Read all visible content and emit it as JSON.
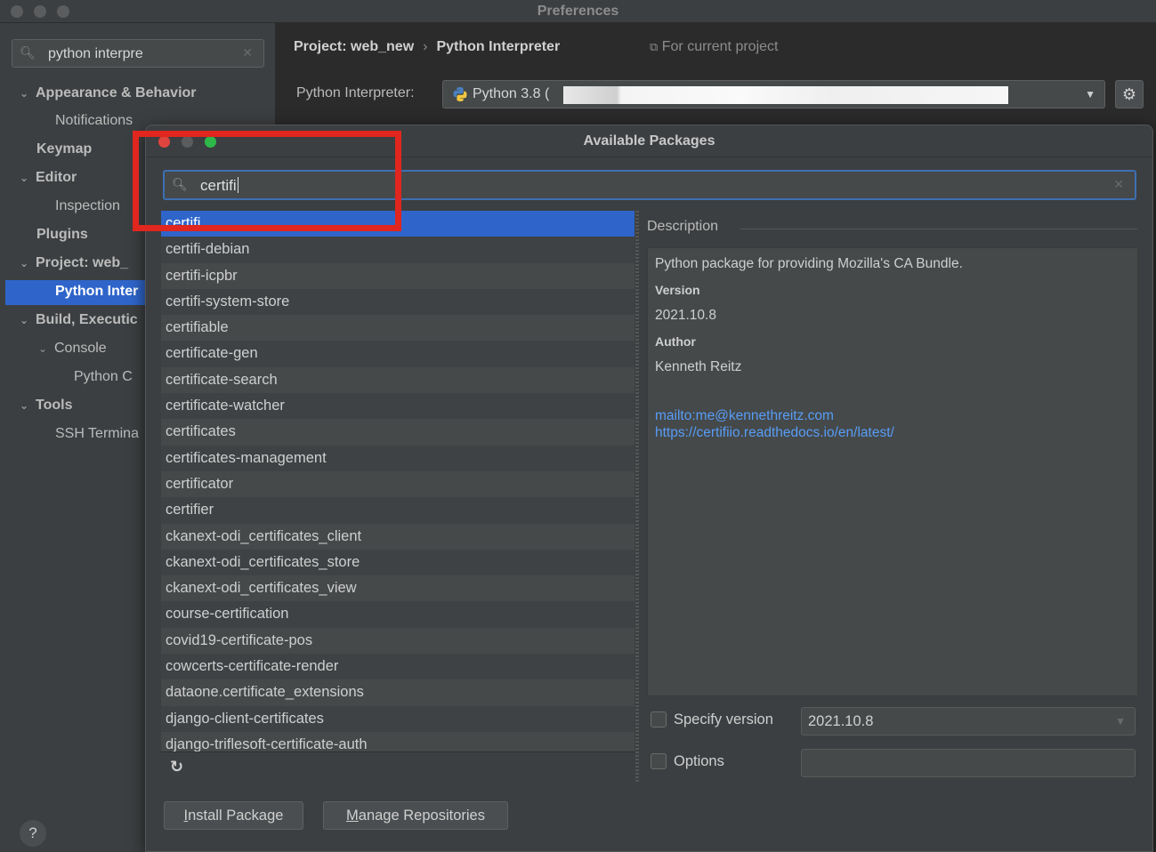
{
  "window": {
    "title": "Preferences"
  },
  "sidebar": {
    "search_value": "python interpre",
    "items": [
      {
        "label": "Appearance & Behavior",
        "bold": true,
        "chevron": true
      },
      {
        "label": "Notifications",
        "bold": false,
        "chevron": false
      },
      {
        "label": "Keymap",
        "bold": true,
        "chevron": false
      },
      {
        "label": "Editor",
        "bold": true,
        "chevron": true
      },
      {
        "label": "Inspection",
        "bold": false,
        "chevron": false
      },
      {
        "label": "Plugins",
        "bold": true,
        "chevron": false
      },
      {
        "label": "Project: web_",
        "bold": true,
        "chevron": true
      },
      {
        "label": "Python Inter",
        "bold": true,
        "chevron": false,
        "selected": true
      },
      {
        "label": "Build, Executic",
        "bold": true,
        "chevron": true
      },
      {
        "label": "Console",
        "bold": false,
        "chevron": true
      },
      {
        "label": "Python C",
        "bold": false,
        "chevron": false
      },
      {
        "label": "Tools",
        "bold": true,
        "chevron": true
      },
      {
        "label": "SSH Termina",
        "bold": false,
        "chevron": false
      }
    ],
    "help_label": "?"
  },
  "header": {
    "crumb_project": "Project: web_new",
    "crumb_separator": "›",
    "crumb_page": "Python Interpreter",
    "for_current_project": "For current project",
    "interpreter_label": "Python Interpreter:",
    "interpreter_value": "Python 3.8 ("
  },
  "dialog": {
    "title": "Available Packages",
    "search_value": "certifi",
    "packages": [
      "certifi",
      "certifi-debian",
      "certifi-icpbr",
      "certifi-system-store",
      "certifiable",
      "certificate-gen",
      "certificate-search",
      "certificate-watcher",
      "certificates",
      "certificates-management",
      "certificator",
      "certifier",
      "ckanext-odi_certificates_client",
      "ckanext-odi_certificates_store",
      "ckanext-odi_certificates_view",
      "course-certification",
      "covid19-certificate-pos",
      "cowcerts-certificate-render",
      "dataone.certificate_extensions",
      "django-client-certificates",
      "django-triflesoft-certificate-auth"
    ],
    "selected_index": 0,
    "description": {
      "header": "Description",
      "summary": "Python package for providing Mozilla's CA Bundle.",
      "version_label": "Version",
      "version_value": "2021.10.8",
      "author_label": "Author",
      "author_value": "Kenneth Reitz",
      "link_email": "mailto:me@kennethreitz.com",
      "link_docs": "https://certifiio.readthedocs.io/en/latest/"
    },
    "specify_version_label": "Specify version",
    "specify_version_value": "2021.10.8",
    "options_label": "Options",
    "install_button_first": "I",
    "install_button_rest": "nstall Package",
    "manage_button_first": "M",
    "manage_button_rest": "anage Repositories"
  },
  "colors": {
    "selection": "#2f65ca",
    "annotation_red": "#e0261e",
    "link": "#589df6"
  }
}
